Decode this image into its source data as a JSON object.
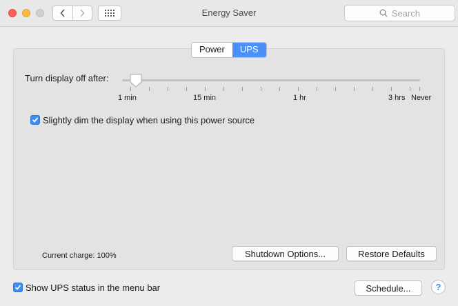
{
  "window": {
    "title": "Energy Saver"
  },
  "search": {
    "placeholder": "Search"
  },
  "tabs": [
    {
      "label": "Power",
      "selected": false
    },
    {
      "label": "UPS",
      "selected": true
    }
  ],
  "slider": {
    "label": "Turn display off after:",
    "ticks": [
      "1 min",
      "15 min",
      "1 hr",
      "3 hrs",
      "Never"
    ],
    "value": "1 min"
  },
  "dim_option": {
    "label": "Slightly dim the display when using this power source",
    "checked": true
  },
  "status": {
    "charge": "Current charge: 100%"
  },
  "buttons": {
    "shutdown": "Shutdown Options...",
    "restore": "Restore Defaults",
    "schedule": "Schedule...",
    "help": "?"
  },
  "menubar_option": {
    "label": "Show UPS status in the menu bar",
    "checked": true
  },
  "colors": {
    "accent": "#4a90f7",
    "close": "#fc605b",
    "minimize": "#fdbc40"
  }
}
